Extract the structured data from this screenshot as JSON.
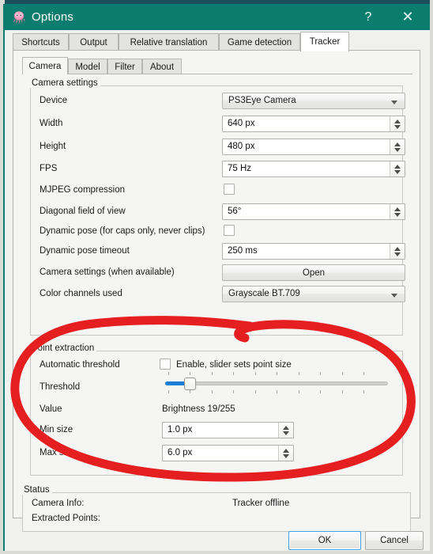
{
  "window": {
    "title": "Options",
    "icon": "opentrack-octopus-icon",
    "help_label": "?",
    "close_label": "✕",
    "titlebar_color": "#0a7d6e"
  },
  "outer_tabs": [
    {
      "label": "Shortcuts",
      "active": false
    },
    {
      "label": "Output",
      "active": false
    },
    {
      "label": "Relative translation",
      "active": false
    },
    {
      "label": "Game detection",
      "active": false
    },
    {
      "label": "Tracker",
      "active": true
    }
  ],
  "inner_tabs": [
    {
      "label": "Camera",
      "active": true
    },
    {
      "label": "Model",
      "active": false
    },
    {
      "label": "Filter",
      "active": false
    },
    {
      "label": "About",
      "active": false
    }
  ],
  "camera_settings": {
    "group_title": "Camera settings",
    "rows": [
      {
        "label": "Device",
        "type": "combo",
        "value": "PS3Eye Camera"
      },
      {
        "label": "Width",
        "type": "spin",
        "value": "640 px"
      },
      {
        "label": "Height",
        "type": "spin",
        "value": "480 px"
      },
      {
        "label": "FPS",
        "type": "spin",
        "value": "75 Hz"
      },
      {
        "label": "MJPEG compression",
        "type": "checkbox",
        "checked": false
      },
      {
        "label": "Diagonal field of view",
        "type": "spin",
        "value": "56°"
      },
      {
        "label": "Dynamic pose (for caps only, never clips)",
        "type": "checkbox",
        "checked": false
      },
      {
        "label": "Dynamic pose timeout",
        "type": "spin",
        "value": "250 ms"
      },
      {
        "label": "Camera settings (when available)",
        "type": "button",
        "value": "Open"
      },
      {
        "label": "Color channels used",
        "type": "combo",
        "value": "Grayscale BT.709"
      }
    ]
  },
  "point_extraction": {
    "group_title": "Point extraction",
    "group_title_obscured": true,
    "auto_threshold": {
      "label": "Automatic threshold",
      "checkbox_label": "Enable, slider sets point size",
      "checked": false
    },
    "threshold": {
      "label": "Threshold",
      "position_percent": 8,
      "tick_count": 11
    },
    "value": {
      "label": "Value",
      "text": "Brightness 19/255"
    },
    "min_size": {
      "label": "Min size",
      "value": "1.0 px"
    },
    "max_size": {
      "label": "Max size",
      "value": "6.0 px"
    }
  },
  "status": {
    "group_title": "Status",
    "camera_info_label": "Camera Info:",
    "camera_info_value": "Tracker offline",
    "extracted_points_label": "Extracted Points:",
    "extracted_points_value": ""
  },
  "dialog_buttons": {
    "ok": "OK",
    "cancel": "Cancel"
  },
  "annotation": {
    "type": "hand-drawn-red-ellipse",
    "color": "#e51f1f"
  }
}
